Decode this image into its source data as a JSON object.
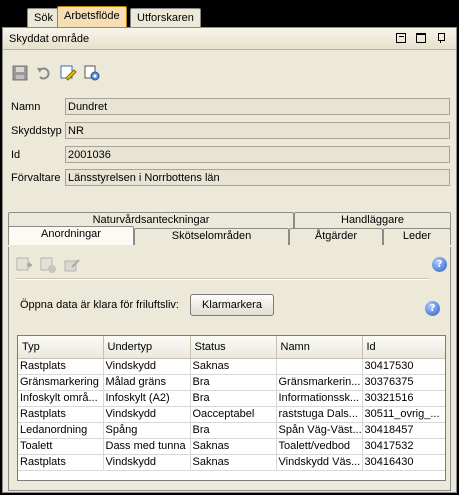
{
  "top_tabs": [
    "Sök",
    "Arbetsflöde",
    "Utforskaren"
  ],
  "panel": {
    "title": "Skyddat område"
  },
  "toolbar_icons": [
    "save-icon",
    "undo-icon",
    "edit-icon",
    "view-icon"
  ],
  "fields": [
    {
      "label": "Namn",
      "value": "Dundret"
    },
    {
      "label": "Skyddstyp",
      "value": "NR"
    },
    {
      "label": "Id",
      "value": "2001036"
    },
    {
      "label": "Förvaltare",
      "value": "Länsstyrelsen i Norrbottens län"
    }
  ],
  "subtabs_back": [
    "Naturvårdsanteckningar",
    "Handläggare"
  ],
  "subtabs_front": [
    "Anordningar",
    "Skötselområden",
    "Åtgärder",
    "Leder"
  ],
  "active_subtab": "Anordningar",
  "content": {
    "open_data_label": "Öppna data är klara för friluftsliv:",
    "clear_button": "Klarmarkera",
    "help": "?"
  },
  "table": {
    "columns": [
      "Typ",
      "Undertyp",
      "Status",
      "Namn",
      "Id"
    ],
    "rows": [
      [
        "Rastplats",
        "Vindskydd",
        "Saknas",
        "",
        "30417530"
      ],
      [
        "Gränsmarkering",
        "Målad gräns",
        "Bra",
        "Gränsmarkerin...",
        "30376375"
      ],
      [
        "Infoskylt områ...",
        "Infoskylt (A2)",
        "Bra",
        "Informationssk...",
        "30321516"
      ],
      [
        "Rastplats",
        "Vindskydd",
        "Oacceptabel",
        "raststuga Dals...",
        "30511_ovrig_..."
      ],
      [
        "Ledanordning",
        "Spång",
        "Bra",
        "Spån Väg-Väst...",
        "30418457"
      ],
      [
        "Toalett",
        "Dass med tunna",
        "Saknas",
        "Toalett/vedbod",
        "30417532"
      ],
      [
        "Rastplats",
        "Vindskydd",
        "Saknas",
        "Vindskydd Väs...",
        "30416430"
      ]
    ]
  }
}
